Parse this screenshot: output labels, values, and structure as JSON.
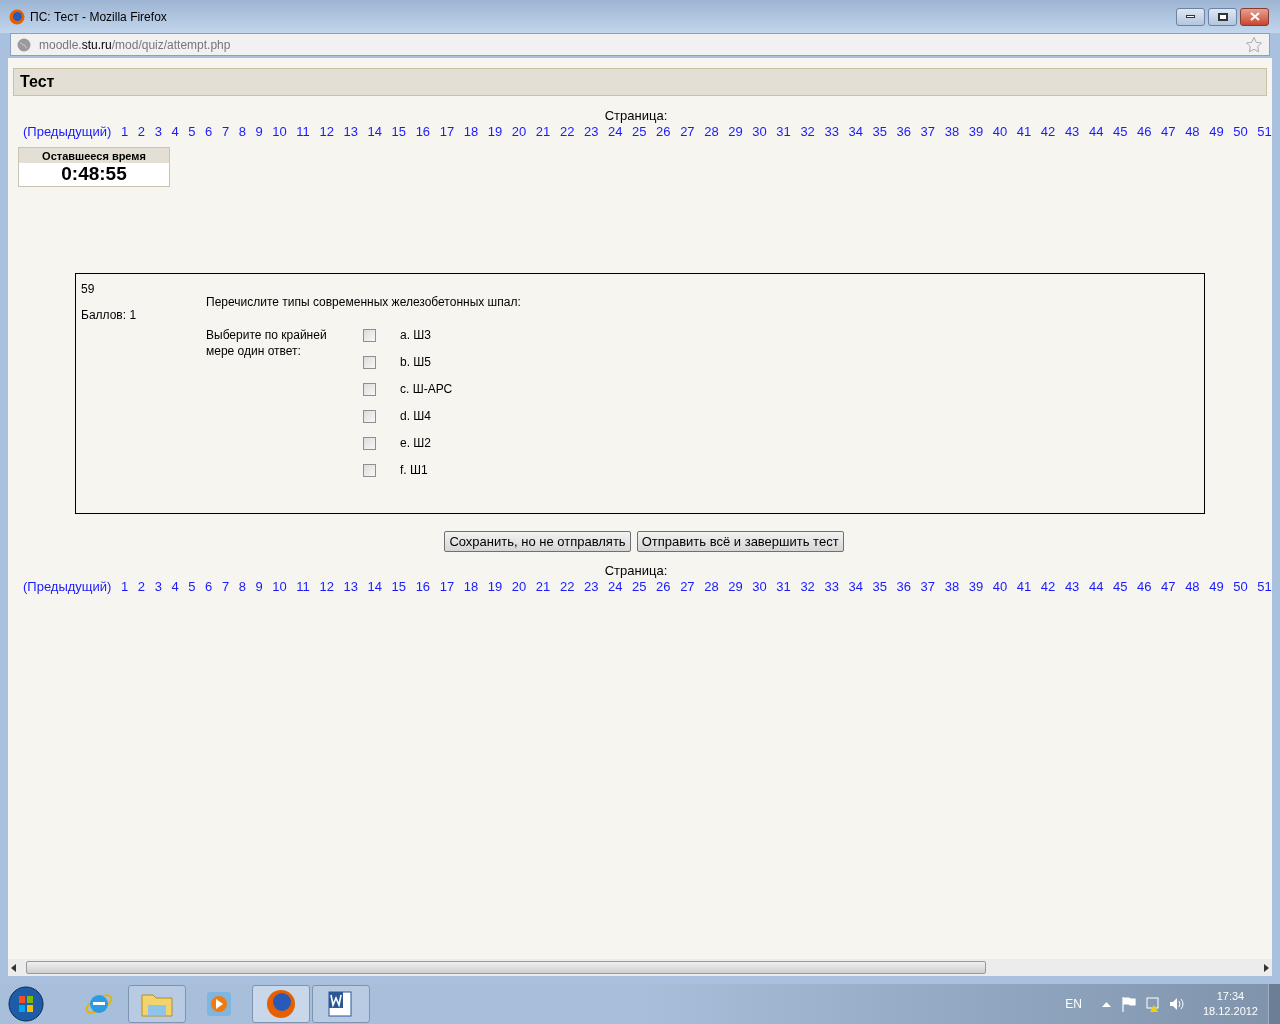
{
  "window": {
    "title": "ПС: Тест - Mozilla Firefox"
  },
  "address_bar": {
    "url": "moodle.**stu.ru**/mod/quiz/attempt.php"
  },
  "page_heading": "Тест",
  "pager_top": {
    "label": "Страница:",
    "previous": "(Предыдущий)",
    "pages": [
      "1",
      "2",
      "3",
      "4",
      "5",
      "6",
      "7",
      "8",
      "9",
      "10",
      "11",
      "12",
      "13",
      "14",
      "15",
      "16",
      "17",
      "18",
      "19",
      "20",
      "21",
      "22",
      "23",
      "24",
      "25",
      "26",
      "27",
      "28",
      "29",
      "30",
      "31",
      "32",
      "33",
      "34",
      "35",
      "36",
      "37",
      "38",
      "39",
      "40",
      "41",
      "42",
      "43",
      "44",
      "45",
      "46",
      "47",
      "48",
      "49",
      "50",
      "51"
    ]
  },
  "timer": {
    "label": "Оставшееся время",
    "value": "0:48:55"
  },
  "question": {
    "number": "59",
    "points": "Баллов: 1",
    "text": "Перечислите типы современных железобетонных шпал:",
    "prompt": "Выберите по крайней мере один ответ:",
    "answers": [
      {
        "label": "a. Ш3",
        "checked": false
      },
      {
        "label": "b. Ш5",
        "checked": false
      },
      {
        "label": "c. Ш-АРС",
        "checked": false
      },
      {
        "label": "d. Ш4",
        "checked": false
      },
      {
        "label": "e. Ш2",
        "checked": false
      },
      {
        "label": "f. Ш1",
        "checked": false
      }
    ]
  },
  "buttons": [
    "Сохранить, но не отправлять",
    "Отправить всё и завершить тест"
  ],
  "pager_bottom": {
    "label": "Страница:",
    "previous": "(Предыдущий)",
    "pages": [
      "1",
      "2",
      "3",
      "4",
      "5",
      "6",
      "7",
      "8",
      "9",
      "10",
      "11",
      "12",
      "13",
      "14",
      "15",
      "16",
      "17",
      "18",
      "19",
      "20",
      "21",
      "22",
      "23",
      "24",
      "25",
      "26",
      "27",
      "28",
      "29",
      "30",
      "31",
      "32",
      "33",
      "34",
      "35",
      "36",
      "37",
      "38",
      "39",
      "40",
      "41",
      "42",
      "43",
      "44",
      "45",
      "46",
      "47",
      "48",
      "49",
      "50",
      "51"
    ]
  },
  "taskbar": {
    "language": "EN",
    "time": "17:34",
    "date": "18.12.2012"
  }
}
